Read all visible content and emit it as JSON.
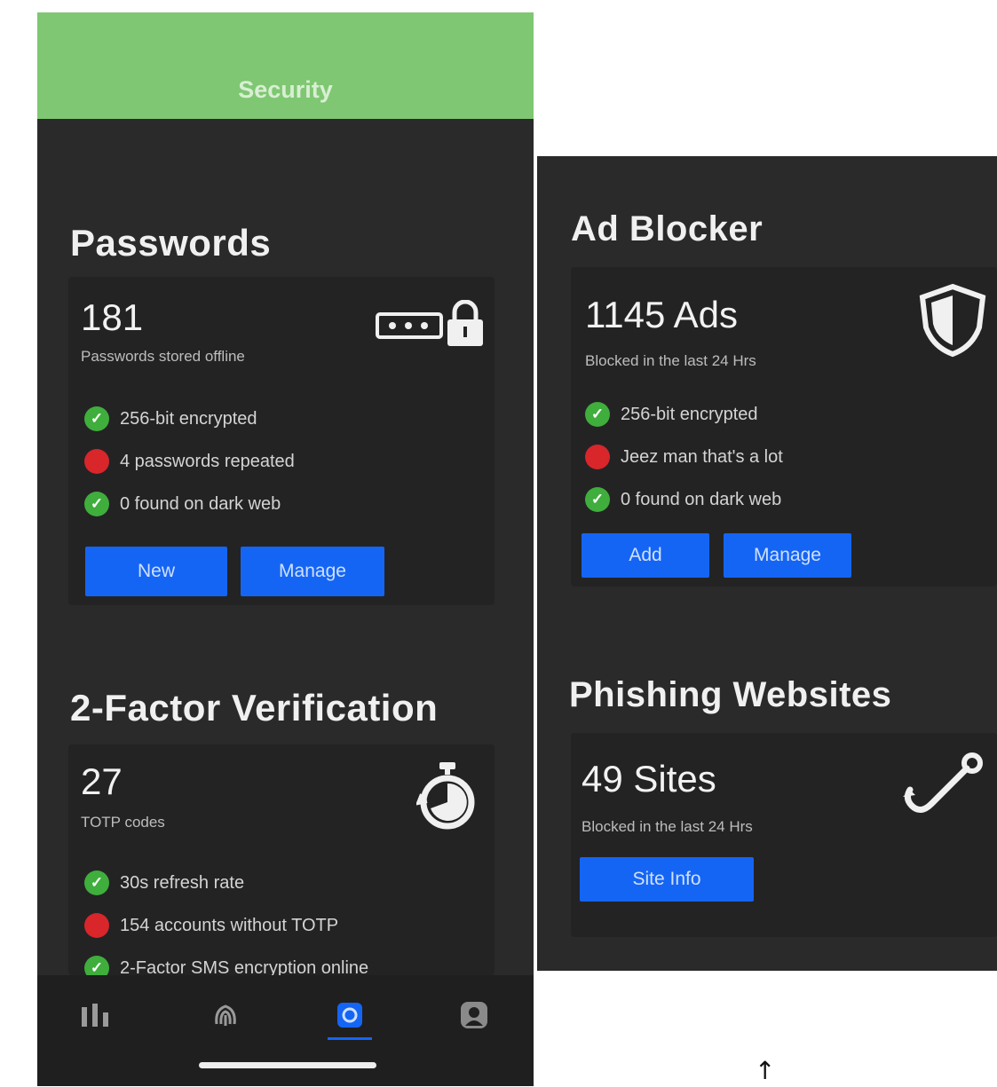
{
  "header": {
    "title": "Security",
    "color": "#7fc772"
  },
  "passwords": {
    "title": "Passwords",
    "count": "181",
    "subtitle": "Passwords stored offline",
    "icon": "password-lock-icon",
    "checks": [
      {
        "status": "ok",
        "text": "256-bit encrypted"
      },
      {
        "status": "warn",
        "text": "4 passwords repeated"
      },
      {
        "status": "ok",
        "text": "0 found on dark web"
      }
    ],
    "buttons": {
      "new": "New",
      "manage": "Manage"
    }
  },
  "two_factor": {
    "title": "2-Factor Verification",
    "count": "27",
    "subtitle": "TOTP codes",
    "icon": "stopwatch-icon",
    "checks": [
      {
        "status": "ok",
        "text": "30s refresh rate"
      },
      {
        "status": "warn",
        "text": "154 accounts without TOTP"
      },
      {
        "status": "ok",
        "text": "2-Factor SMS encryption online"
      }
    ]
  },
  "tabbar": {
    "items": [
      {
        "icon": "stats-icon"
      },
      {
        "icon": "fingerprint-icon"
      },
      {
        "icon": "security-icon",
        "active": true
      },
      {
        "icon": "profile-icon"
      }
    ]
  },
  "ad_blocker": {
    "title": "Ad Blocker",
    "count": "1145 Ads",
    "subtitle": "Blocked in the last 24 Hrs",
    "icon": "shield-icon",
    "checks": [
      {
        "status": "ok",
        "text": "256-bit encrypted"
      },
      {
        "status": "warn",
        "text": "Jeez man that's a lot"
      },
      {
        "status": "ok",
        "text": "0 found on dark web"
      }
    ],
    "buttons": {
      "add": "Add",
      "manage": "Manage"
    }
  },
  "phishing": {
    "title": "Phishing Websites",
    "count": "49 Sites",
    "subtitle": "Blocked in the last 24 Hrs",
    "icon": "fishing-hook-icon",
    "buttons": {
      "site_info": "Site Info"
    }
  },
  "annotation": {
    "arrow": "↑"
  },
  "colors": {
    "accent_blue": "#1565f4",
    "ok_green": "#3fae3c",
    "warn_red": "#d8262a",
    "panel_bg": "#2a2a2b"
  }
}
